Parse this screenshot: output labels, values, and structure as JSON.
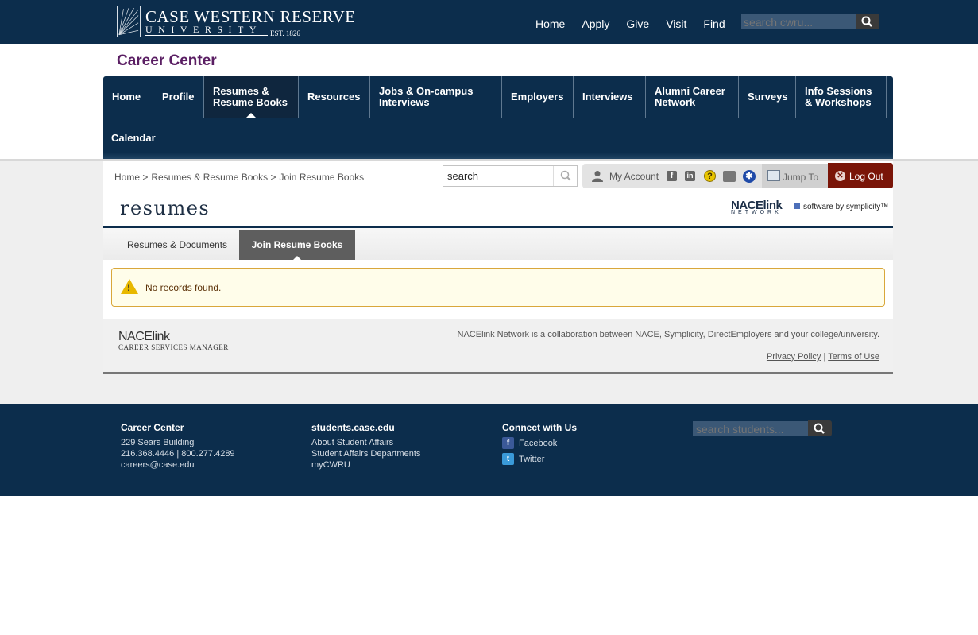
{
  "header": {
    "logo_line1": "CASE WESTERN RESERVE",
    "logo_line2": "UNIVERSITY",
    "logo_est": "EST. 1826",
    "nav": [
      "Home",
      "Apply",
      "Give",
      "Visit",
      "Find"
    ],
    "search_placeholder": "search cwru..."
  },
  "site_title": "Career Center",
  "main_nav": {
    "items": [
      {
        "label": "Home"
      },
      {
        "label": "Profile"
      },
      {
        "label": "Resumes & Resume Books"
      },
      {
        "label": "Resources"
      },
      {
        "label": "Jobs & On-campus Interviews"
      },
      {
        "label": "Employers"
      },
      {
        "label": "Interviews"
      },
      {
        "label": "Alumni Career Network"
      },
      {
        "label": "Surveys"
      },
      {
        "label": "Info Sessions & Workshops"
      },
      {
        "label": "Calendar"
      }
    ],
    "active_index": 2
  },
  "breadcrumb": [
    "Home",
    ">",
    "Resumes & Resume Books",
    ">",
    "Join Resume Books"
  ],
  "search": {
    "value": "search"
  },
  "utility": {
    "my_account": "My Account",
    "jump_to": "Jump To",
    "log_out": "Log Out"
  },
  "page_heading": "resumes",
  "nace_network": {
    "line1": "NACElink",
    "line2": "NETWORK"
  },
  "symplicity": "software by symplicity™",
  "subtabs": [
    "Resumes & Documents",
    "Join Resume Books"
  ],
  "active_subtab": 1,
  "alert": {
    "message": "No records found."
  },
  "panel_footer": {
    "logo_line1": "NACElink",
    "logo_line2": "CAREER SERVICES MANAGER",
    "collab_text": "NACElink Network is a collaboration between NACE, Symplicity, DirectEmployers and your college/university.",
    "privacy": "Privacy Policy",
    "separator": "|",
    "terms": "Terms of Use"
  },
  "footer": {
    "col1": {
      "heading": "Career Center",
      "lines": [
        "229 Sears Building",
        "216.368.4446 | 800.277.4289",
        "careers@case.edu"
      ]
    },
    "col2": {
      "heading": "students.case.edu",
      "links": [
        "About Student Affairs",
        "Student Affairs Departments",
        "myCWRU"
      ]
    },
    "col3": {
      "heading": "Connect with Us",
      "links": [
        "Facebook",
        "Twitter"
      ]
    },
    "search_placeholder": "search students..."
  },
  "colors": {
    "navy": "#0c2d4c",
    "purple": "#5a1e63",
    "logout_red": "#7a1508",
    "alert_bg": "#fffdea"
  }
}
